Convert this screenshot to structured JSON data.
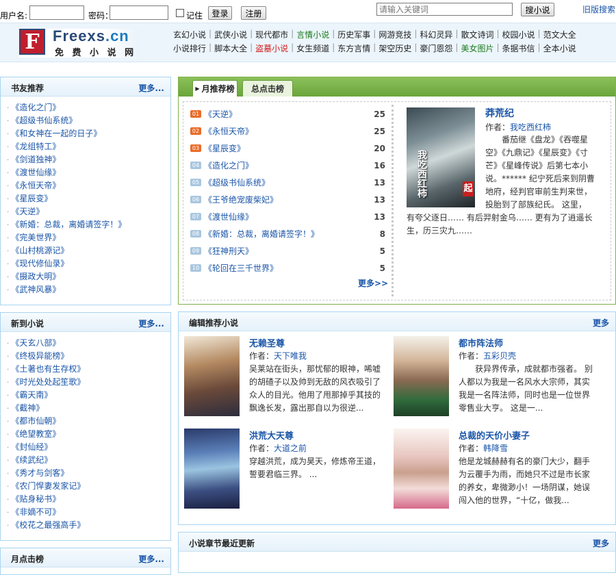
{
  "login": {
    "username_label": "用户名:",
    "password_label": "密码：",
    "remember_label": "记住",
    "login_btn": "登录",
    "register_btn": "注册"
  },
  "search": {
    "placeholder": "请输入关键词",
    "button": "搜小说",
    "old_search": "旧版搜索"
  },
  "logo": {
    "name_a": "Freexs",
    "name_b": ".cn",
    "subtitle": "免 费 小 说 网"
  },
  "nav": {
    "row1": [
      "玄幻小说",
      "武侠小说",
      "现代都市",
      "言情小说",
      "历史军事",
      "网游竞技",
      "科幻灵异",
      "散文诗词",
      "校园小说",
      "范文大全"
    ],
    "row2": [
      "小说排行",
      "脚本大全",
      "盗墓小说",
      "女生频道",
      "东方言情",
      "架空历史",
      "豪门恩怨",
      "美女图片",
      "条据书信",
      "全本小说"
    ]
  },
  "friend_rec": {
    "title": "书友推荐",
    "more": "更多...",
    "items": [
      "《造化之门》",
      "《超级书仙系统》",
      "《和女神在一起的日子》",
      "《龙组特工》",
      "《剑道独神》",
      "《渡世仙缘》",
      "《永恒天帝》",
      "《星辰变》",
      "《天逆》",
      "《新婚：总裁，离婚请签字！》",
      "《完美世界》",
      "《山村桃源记》",
      "《现代修仙录》",
      "《摄政大明》",
      "《武神风暴》"
    ]
  },
  "new_arrivals": {
    "title": "新到小说",
    "more": "更多...",
    "items": [
      "《天玄八部》",
      "《终极异能榜》",
      "《土著也有生存权》",
      "《时光处处起笙歌》",
      "《霸天南》",
      "《截神》",
      "《都市仙朝》",
      "《绝望教室》",
      "《封仙经》",
      "《续武纪》",
      "《秀才与剑客》",
      "《农门悍妻发家记》",
      "《贴身秘书》",
      "《非嫡不可》",
      "《校花之最强高手》"
    ]
  },
  "monthly_box": {
    "title": "月点击榜",
    "more": "更多..."
  },
  "rank_tabs": {
    "tab1": "月推荐榜",
    "tab2": "总点击榜",
    "more": "更多>>"
  },
  "rank_list": [
    {
      "n": "01",
      "name": "《天逆》",
      "count": "25"
    },
    {
      "n": "02",
      "name": "《永恒天帝》",
      "count": "25"
    },
    {
      "n": "03",
      "name": "《星辰变》",
      "count": "20"
    },
    {
      "n": "04",
      "name": "《造化之门》",
      "count": "16"
    },
    {
      "n": "05",
      "name": "《超级书仙系统》",
      "count": "13"
    },
    {
      "n": "06",
      "name": "《王爷绝宠废柴妃》",
      "count": "13"
    },
    {
      "n": "07",
      "name": "《渡世仙缘》",
      "count": "13"
    },
    {
      "n": "08",
      "name": "《新婚：总裁，离婚请签字！》",
      "count": "8"
    },
    {
      "n": "09",
      "name": "《狂神刑天》",
      "count": "5"
    },
    {
      "n": "10",
      "name": "《轮回在三千世界》",
      "count": "5"
    }
  ],
  "featured": {
    "title": "莽荒纪",
    "author_label": "作者：",
    "author": "我吃西红柿",
    "cover_text": "我吃西红柿",
    "cover_logo": "起",
    "desc": "　　番茄继《盘龙》《吞噬星空》《九鼎记》《星辰变》《寸芒》《星峰传说》后第七本小说。****** 纪宁死后来到阴曹地府，经判官审前生判来世，投胎到了部族纪氏。 这里， 有夸父逐日…… 有后羿射金乌…… 更有为了逍遥长生，历三灾九……"
  },
  "editor_rec": {
    "title": "编辑推荐小说",
    "more": "更多",
    "books": [
      {
        "title": "无赖圣尊",
        "author_label": "作者：",
        "author": "天下唯我",
        "desc": "吴莱站在街头，那忧郁的眼神，唏嘘的胡碴子以及帅到无敌的风衣吸引了众人的目光。他用了甩那掉乎其技的飘逸长发，露出那自以为很逆..."
      },
      {
        "title": "都市阵法师",
        "author_label": "作者：",
        "author": "五彩贝壳",
        "desc": "　　获异界传承，成就都市强者。 别人都以为我是一名风水大宗师，其实我是一名阵法师，同时也是一位世界零售业大亨。 这是一..."
      },
      {
        "title": "洪荒大天尊",
        "author_label": "作者：",
        "author": "大道之前",
        "desc": "穿越洪荒，成为昊天，修炼帝王道，誓要君临三界。 ..."
      },
      {
        "title": "总裁的天价小妻子",
        "author_label": "作者：",
        "author": "韩降雪",
        "desc": "他是龙城赫赫有名的豪门大少，翻手为云覆手为雨，而她只不过是市长家的养女，卑微渺小！一场阴谋，她误闯入他的世界，“十亿，做我..."
      }
    ]
  },
  "chapter_update": {
    "title": "小说章节最近更新",
    "more": "更多"
  },
  "colors": {
    "link": "#1a55a8",
    "box_border": "#a8d4ef",
    "tab_green": "#6aa53a",
    "rank_hot": "#e86d2a"
  }
}
